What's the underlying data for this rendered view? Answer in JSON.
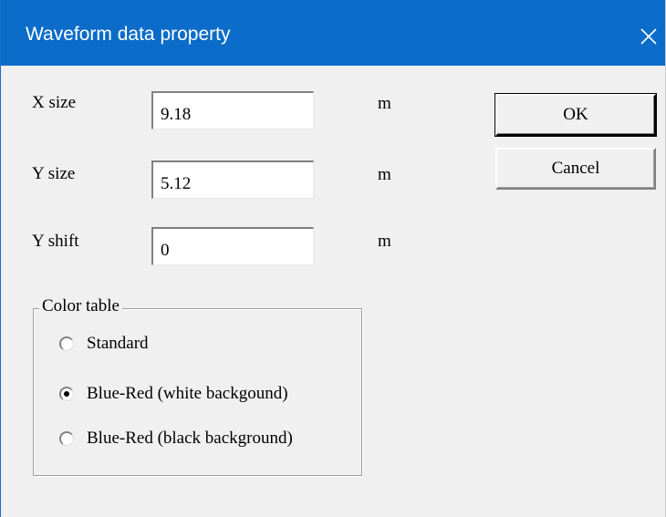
{
  "dialog": {
    "title": "Waveform data property",
    "close_icon": "close-icon"
  },
  "fields": [
    {
      "label": "X size",
      "value": "9.18",
      "unit": "m"
    },
    {
      "label": "Y size",
      "value": "5.12",
      "unit": "m"
    },
    {
      "label": "Y shift",
      "value": "0",
      "unit": "m"
    }
  ],
  "buttons": {
    "ok": "OK",
    "cancel": "Cancel"
  },
  "color_table": {
    "legend": "Color table",
    "options": [
      {
        "label": "Standard",
        "selected": false
      },
      {
        "label": "Blue-Red (white backgound)",
        "selected": true
      },
      {
        "label": "Blue-Red (black background)",
        "selected": false
      }
    ]
  },
  "colors": {
    "titlebar": "#0b6cc9",
    "dialog_bg": "#f0f0f0"
  }
}
